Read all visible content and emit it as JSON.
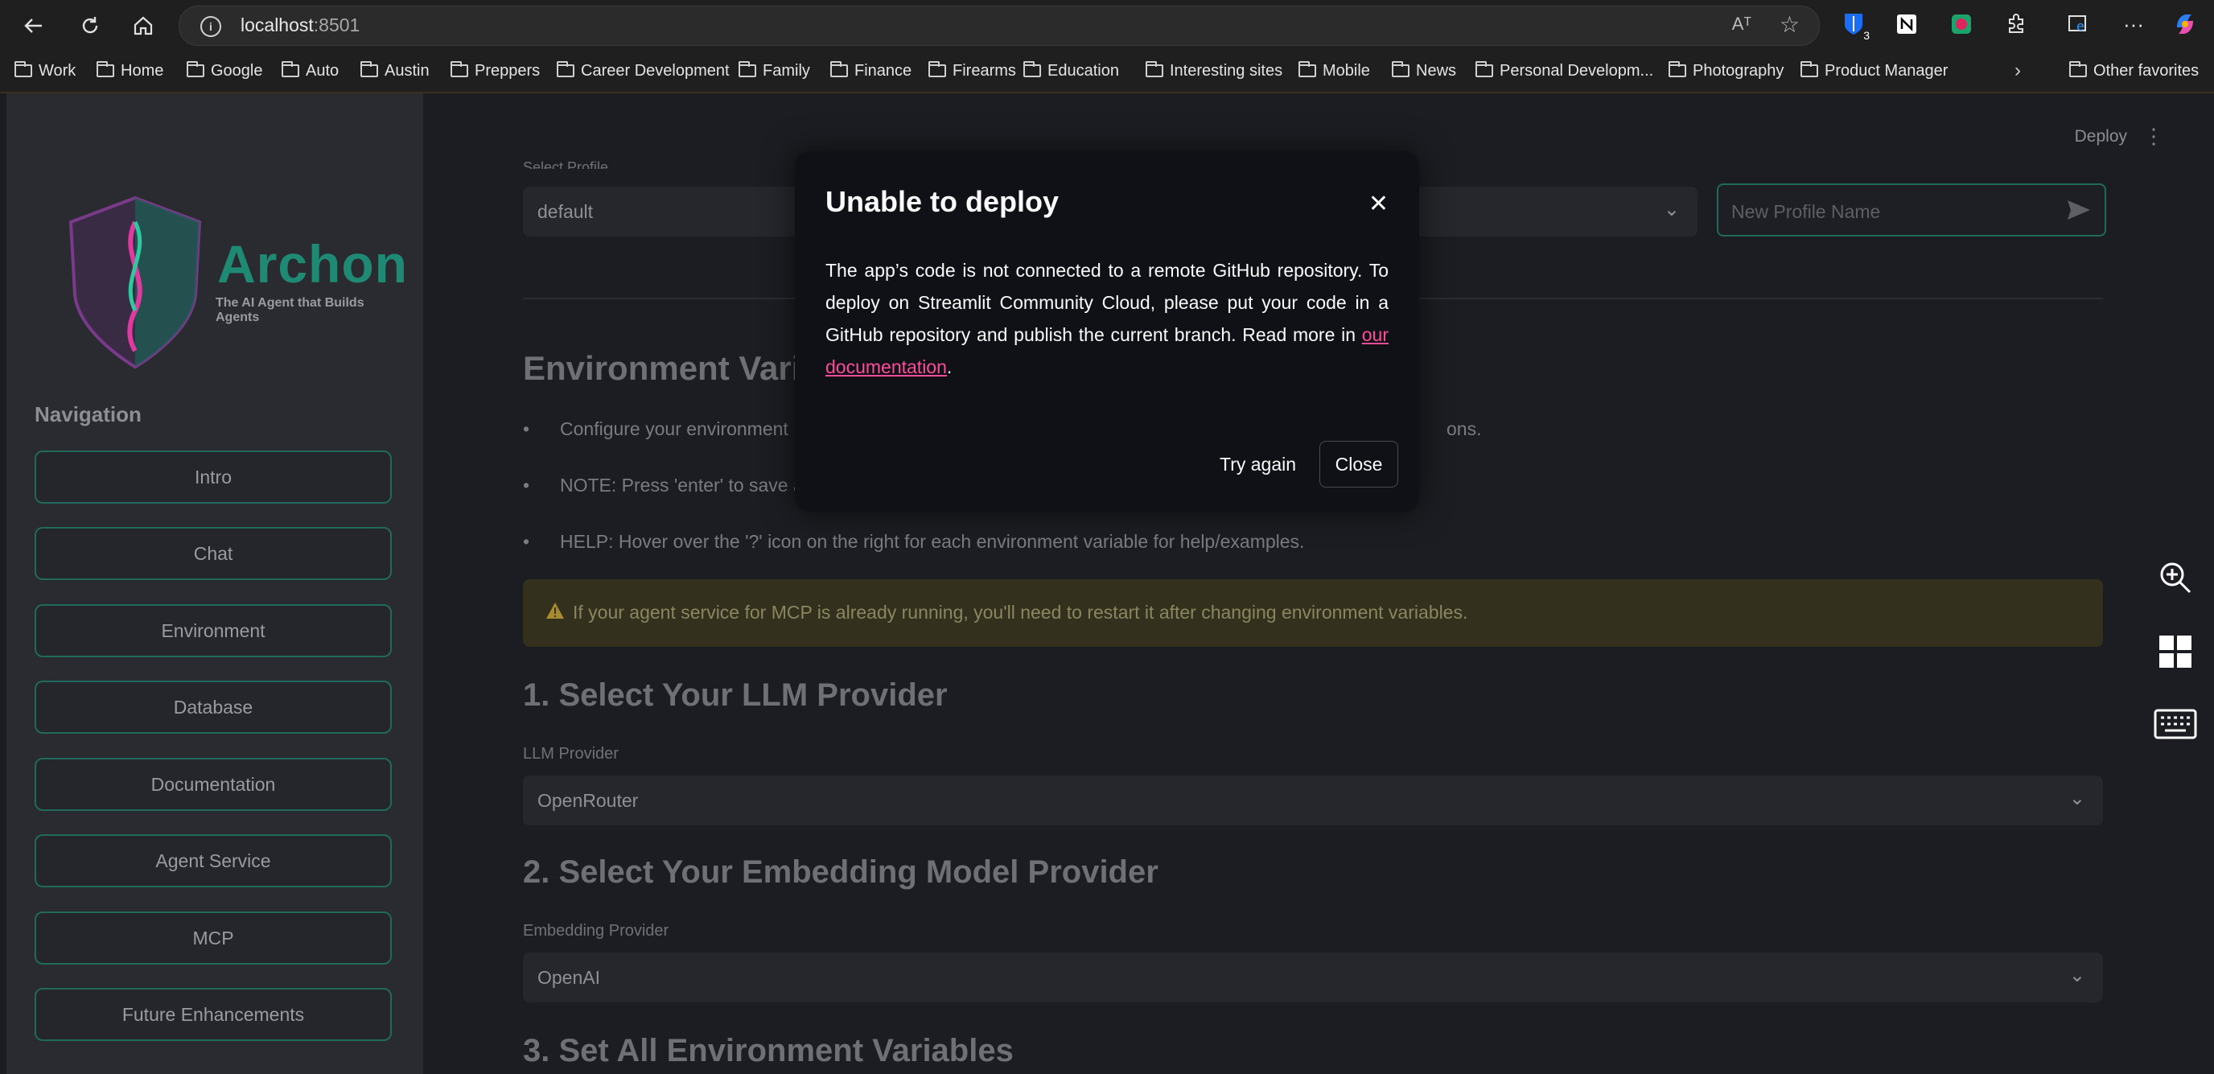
{
  "browser": {
    "url_host": "localhost",
    "url_port": ":8501",
    "read_aloud": "Aᵀ",
    "extension_badge": "3",
    "bookmarks": [
      "Work",
      "Home",
      "Google",
      "Auto",
      "Austin",
      "Preppers",
      "Career Development",
      "Family",
      "Finance",
      "Firearms",
      "Education",
      "Interesting sites",
      "Mobile",
      "News",
      "Personal Developm...",
      "Photography",
      "Product Manager"
    ],
    "other_favorites": "Other favorites"
  },
  "sidebar": {
    "logo_title": "Archon",
    "logo_tagline": "The AI Agent that Builds Agents",
    "nav_title": "Navigation",
    "nav_items": [
      "Intro",
      "Chat",
      "Environment",
      "Database",
      "Documentation",
      "Agent Service",
      "MCP",
      "Future Enhancements"
    ]
  },
  "header": {
    "deploy": "Deploy"
  },
  "main": {
    "profile_label": "Select Profile",
    "profile_value": "default",
    "new_profile_placeholder": "New Profile Name",
    "env_heading": "Environment Varia",
    "bullet1_start": "Configure your environment",
    "bullet1_end": "ons.",
    "bullet2_start": "NOTE: Press 'enter' to save a",
    "bullet3": "HELP: Hover over the '?' icon on the right for each environment variable for help/examples.",
    "warning": "If your agent service for MCP is already running, you'll need to restart it after changing environment variables.",
    "section1": "1. Select Your LLM Provider",
    "llm_label": "LLM Provider",
    "llm_value": "OpenRouter",
    "section2": "2. Select Your Embedding Model Provider",
    "embed_label": "Embedding Provider",
    "embed_value": "OpenAI",
    "section3": "3. Set All Environment Variables"
  },
  "modal": {
    "title": "Unable to deploy",
    "body": "The app’s code is not connected to a remote GitHub repository. To deploy on Streamlit Community Cloud, please put your code in a GitHub repository and publish the current branch. Read more in ",
    "link": "our documentation",
    "period": ".",
    "try_again": "Try again",
    "close": "Close"
  },
  "colors": {
    "accent_green": "#1f6a5a",
    "link_pink": "#ff4b9a",
    "warning_bg": "#33311e"
  }
}
